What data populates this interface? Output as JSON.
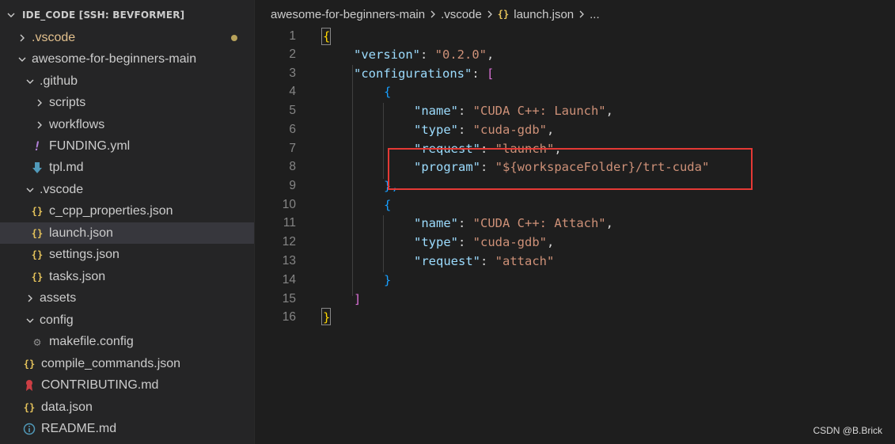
{
  "explorer": {
    "title": "IDE_CODE [SSH: BEVFORMER]",
    "items": [
      {
        "label": ".vscode",
        "kind": "folder",
        "state": "collapsed",
        "modified": true
      },
      {
        "label": "awesome-for-beginners-main",
        "kind": "folder",
        "state": "expanded"
      },
      {
        "label": ".github",
        "kind": "folder",
        "state": "expanded"
      },
      {
        "label": "scripts",
        "kind": "folder",
        "state": "collapsed"
      },
      {
        "label": "workflows",
        "kind": "folder",
        "state": "collapsed"
      },
      {
        "label": "FUNDING.yml",
        "kind": "file",
        "icon": "exclamation-icon"
      },
      {
        "label": "tpl.md",
        "kind": "file",
        "icon": "markdown-download-icon"
      },
      {
        "label": ".vscode",
        "kind": "folder",
        "state": "expanded"
      },
      {
        "label": "c_cpp_properties.json",
        "kind": "file",
        "icon": "json-icon"
      },
      {
        "label": "launch.json",
        "kind": "file",
        "icon": "json-icon",
        "selected": true
      },
      {
        "label": "settings.json",
        "kind": "file",
        "icon": "json-icon"
      },
      {
        "label": "tasks.json",
        "kind": "file",
        "icon": "json-icon"
      },
      {
        "label": "assets",
        "kind": "folder",
        "state": "collapsed"
      },
      {
        "label": "config",
        "kind": "folder",
        "state": "expanded"
      },
      {
        "label": "makefile.config",
        "kind": "file",
        "icon": "gear-icon"
      },
      {
        "label": "compile_commands.json",
        "kind": "file",
        "icon": "json-icon"
      },
      {
        "label": "CONTRIBUTING.md",
        "kind": "file",
        "icon": "ribbon-icon"
      },
      {
        "label": "data.json",
        "kind": "file",
        "icon": "json-icon"
      },
      {
        "label": "README.md",
        "kind": "file",
        "icon": "info-icon"
      }
    ]
  },
  "breadcrumbs": {
    "items": [
      "awesome-for-beginners-main",
      ".vscode",
      "launch.json",
      "..."
    ]
  },
  "editor": {
    "lines": [
      {
        "num": "1"
      },
      {
        "num": "2"
      },
      {
        "num": "3"
      },
      {
        "num": "4"
      },
      {
        "num": "5"
      },
      {
        "num": "6"
      },
      {
        "num": "7"
      },
      {
        "num": "8"
      },
      {
        "num": "9"
      },
      {
        "num": "10"
      },
      {
        "num": "11"
      },
      {
        "num": "12"
      },
      {
        "num": "13"
      },
      {
        "num": "14"
      },
      {
        "num": "15"
      },
      {
        "num": "16"
      }
    ],
    "code": {
      "l1_open": "{",
      "l2_key": "\"version\"",
      "l2_val": "\"0.2.0\"",
      "l3_key": "\"configurations\"",
      "l3_open": "[",
      "l4_open": "{",
      "l5_key": "\"name\"",
      "l5_val": "\"CUDA C++: Launch\"",
      "l6_key": "\"type\"",
      "l6_val": "\"cuda-gdb\"",
      "l7_key": "\"request\"",
      "l7_val": "\"launch\"",
      "l8_key": "\"program\"",
      "l8_val": "\"${workspaceFolder}/trt-cuda\"",
      "l9_close": "},",
      "l10_open": "{",
      "l11_key": "\"name\"",
      "l11_val": "\"CUDA C++: Attach\"",
      "l12_key": "\"type\"",
      "l12_val": "\"cuda-gdb\"",
      "l13_key": "\"request\"",
      "l13_val": "\"attach\"",
      "l14_close": "}",
      "l15_close": "]",
      "l16_close": "}",
      "colon": ": ",
      "comma": ","
    }
  },
  "watermark": "CSDN @B.Brick",
  "colors": {
    "sidebar_bg": "#252526",
    "editor_bg": "#1e1e1e",
    "selected_row": "#37373d",
    "json_key": "#9cdcfe",
    "json_string": "#ce9178",
    "highlight_box": "#e53935"
  }
}
